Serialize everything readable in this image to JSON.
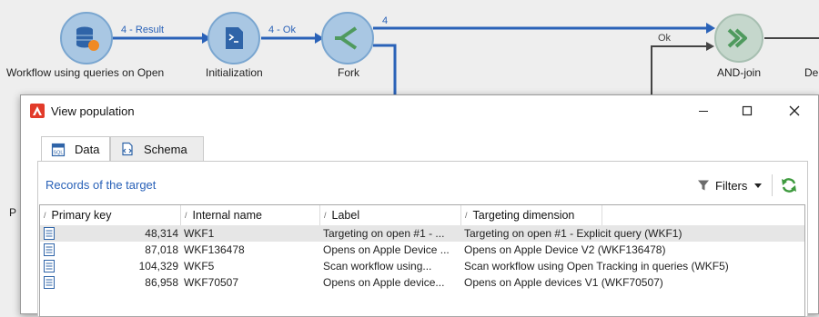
{
  "workflow": {
    "nodes": [
      {
        "label": "Workflow using queries on Open"
      },
      {
        "label": "Initialization"
      },
      {
        "label": "Fork"
      },
      {
        "label": "AND-join"
      },
      {
        "label": "De"
      }
    ],
    "transitions": [
      {
        "label": "4 - Result"
      },
      {
        "label": "4 - Ok"
      },
      {
        "label": "4"
      },
      {
        "label": "Ok"
      }
    ],
    "stray_text": "P"
  },
  "dialog": {
    "title": "View population",
    "tabs": [
      {
        "label": "Data",
        "icon": "sql-table-icon"
      },
      {
        "label": "Schema",
        "icon": "schema-icon"
      }
    ],
    "panel_title": "Records of the target",
    "filters_label": "Filters",
    "columns": [
      "Primary key",
      "Internal name",
      "Label",
      "Targeting dimension"
    ],
    "rows": [
      {
        "primary_key": "48,314",
        "internal_name": "WKF1",
        "label": "Targeting on open #1 - ...",
        "targeting_dimension": "Targeting on open #1 - Explicit query (WKF1)"
      },
      {
        "primary_key": "87,018",
        "internal_name": "WKF136478",
        "label": "Opens on Apple Device ...",
        "targeting_dimension": "Opens on Apple Device V2 (WKF136478)"
      },
      {
        "primary_key": "104,329",
        "internal_name": "WKF5",
        "label": "Scan workflow using...",
        "targeting_dimension": "Scan workflow using Open Tracking in queries (WKF5)"
      },
      {
        "primary_key": "86,958",
        "internal_name": "WKF70507",
        "label": "Opens on Apple device...",
        "targeting_dimension": "Opens on Apple devices V1 (WKF70507)"
      }
    ]
  },
  "colors": {
    "accent": "#2a62b8",
    "node_fill": "#a9c7e3",
    "fork_fill": "#6ba87a",
    "selected_row": "#e6e6e6",
    "brand": "#e23b2a"
  }
}
